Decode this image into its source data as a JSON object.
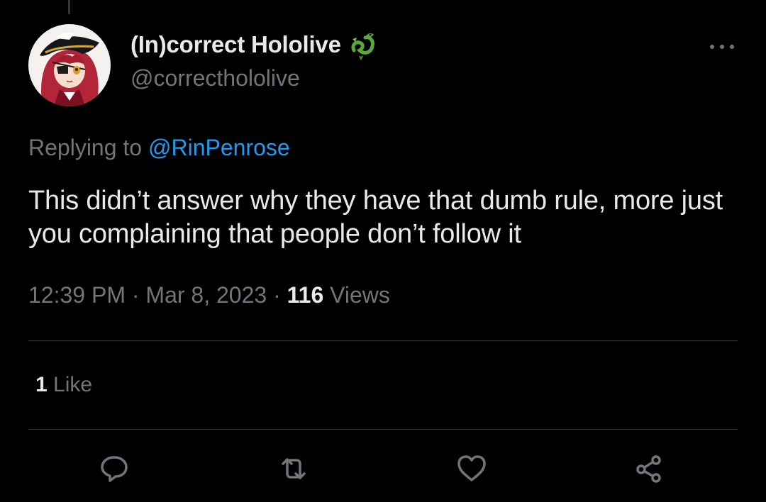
{
  "author": {
    "display_name": "(In)correct Hololive",
    "handle": "@correcthololive",
    "badge_icon": "dragon-emoji",
    "avatar": "anime-pirate-character-avatar"
  },
  "reply": {
    "prefix": "Replying to ",
    "mention": "@RinPenrose"
  },
  "tweet": {
    "text": "This didn’t answer why they have that dumb rule, more just you complaining that people don’t follow it"
  },
  "meta": {
    "time": "12:39 PM",
    "separator": "·",
    "date": "Mar 8, 2023",
    "views_count": "116",
    "views_label": "Views"
  },
  "engagement": {
    "likes_count": "1",
    "likes_label": "Like"
  },
  "actions": [
    {
      "name": "reply",
      "icon": "speech-bubble-icon"
    },
    {
      "name": "retweet",
      "icon": "retweet-icon"
    },
    {
      "name": "like",
      "icon": "heart-icon"
    },
    {
      "name": "share",
      "icon": "share-icon"
    }
  ],
  "colors": {
    "background": "#000000",
    "text_primary": "#e7e9ea",
    "text_secondary": "#71767b",
    "accent_link": "#1d9bf0",
    "divider": "#2f3336"
  }
}
